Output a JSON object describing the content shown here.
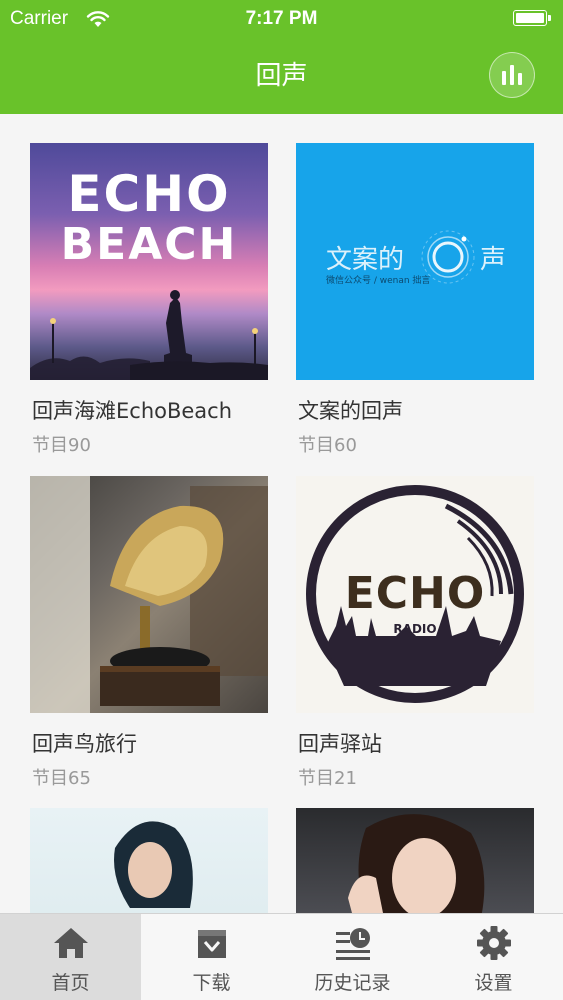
{
  "status_bar": {
    "carrier": "Carrier",
    "time": "7:17 PM"
  },
  "nav": {
    "title": "回声",
    "right_icon": "equalizer-icon"
  },
  "theme": {
    "accent": "#69c22a",
    "title_text": "#333333",
    "subtext": "#999999"
  },
  "cards": [
    {
      "title": "回声海滩EchoBeach",
      "count": "节目90",
      "cover": {
        "line1": "ECHO",
        "line2": "BEACH"
      }
    },
    {
      "title": "文案的回声",
      "count": "节目60",
      "cover": {
        "text_left": "文案的",
        "text_right": "声",
        "caption": "微信公众号 / wenan 拙言"
      }
    },
    {
      "title": "回声鸟旅行",
      "count": "节目65",
      "cover": {}
    },
    {
      "title": "回声驿站",
      "count": "节目21",
      "cover": {
        "logo": "ECHO",
        "sub": "RADIO"
      }
    },
    {
      "title": "",
      "count": "",
      "cover": {}
    },
    {
      "title": "",
      "count": "",
      "cover": {}
    }
  ],
  "tabs": [
    {
      "label": "首页",
      "icon": "home-icon",
      "active": true
    },
    {
      "label": "下载",
      "icon": "download-box-icon",
      "active": false
    },
    {
      "label": "历史记录",
      "icon": "history-clock-icon",
      "active": false
    },
    {
      "label": "设置",
      "icon": "gear-icon",
      "active": false
    }
  ]
}
